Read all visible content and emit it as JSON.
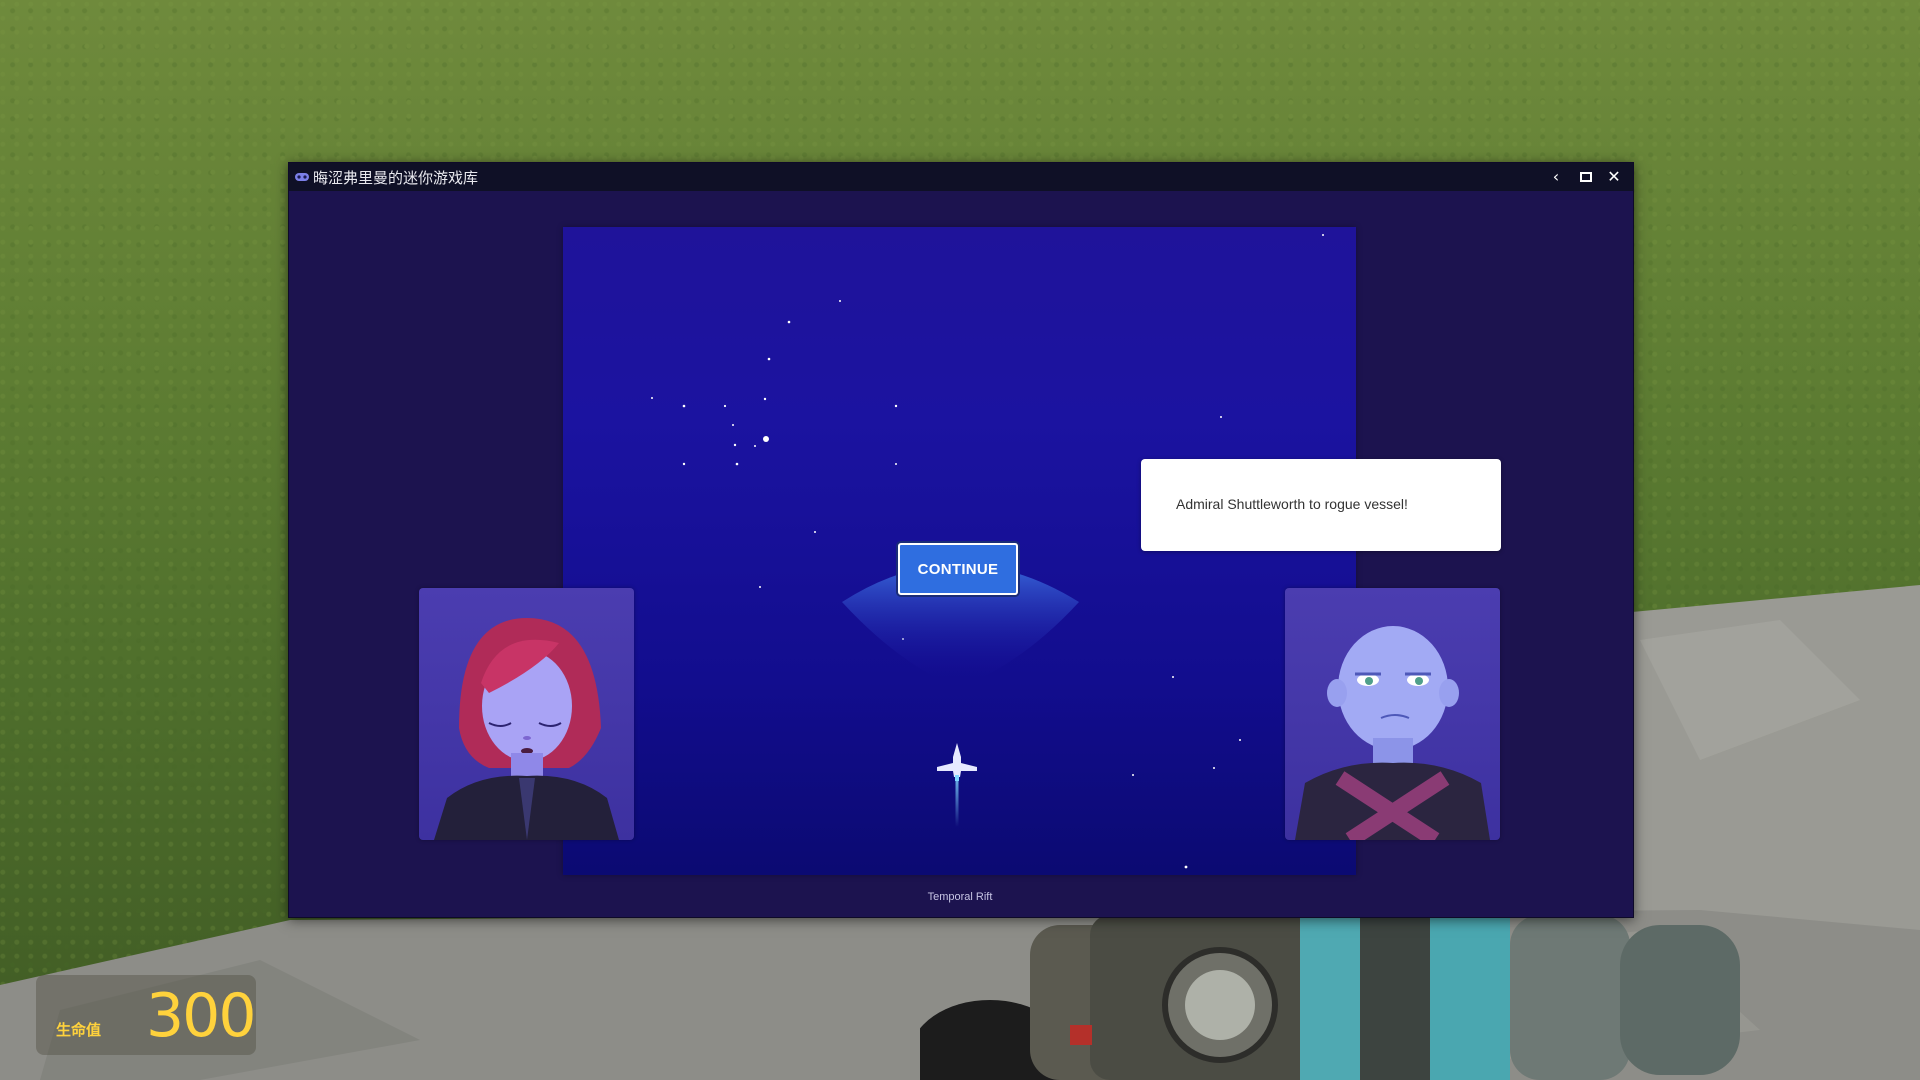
{
  "window": {
    "title": "晦涩弗里曼的迷你游戏库",
    "back_icon": "chevron-left-icon",
    "maximize_icon": "window-maximize-icon",
    "close_icon": "close-icon"
  },
  "game": {
    "continue_label": "CONTINUE",
    "dialog_text": "Admiral Shuttleworth to rogue vessel!",
    "footer_title": "Temporal Rift",
    "left_portrait": "red-haired-female-officer-portrait",
    "right_portrait": "bald-admiral-portrait",
    "player_ship": "starfighter-icon"
  },
  "hud": {
    "health_label": "生命值",
    "health_value": "300"
  },
  "colors": {
    "accent": "#2f6ee0",
    "playfield": "#1b13a0",
    "window_bg": "#1c134f",
    "hud_text": "#ffd23c"
  }
}
